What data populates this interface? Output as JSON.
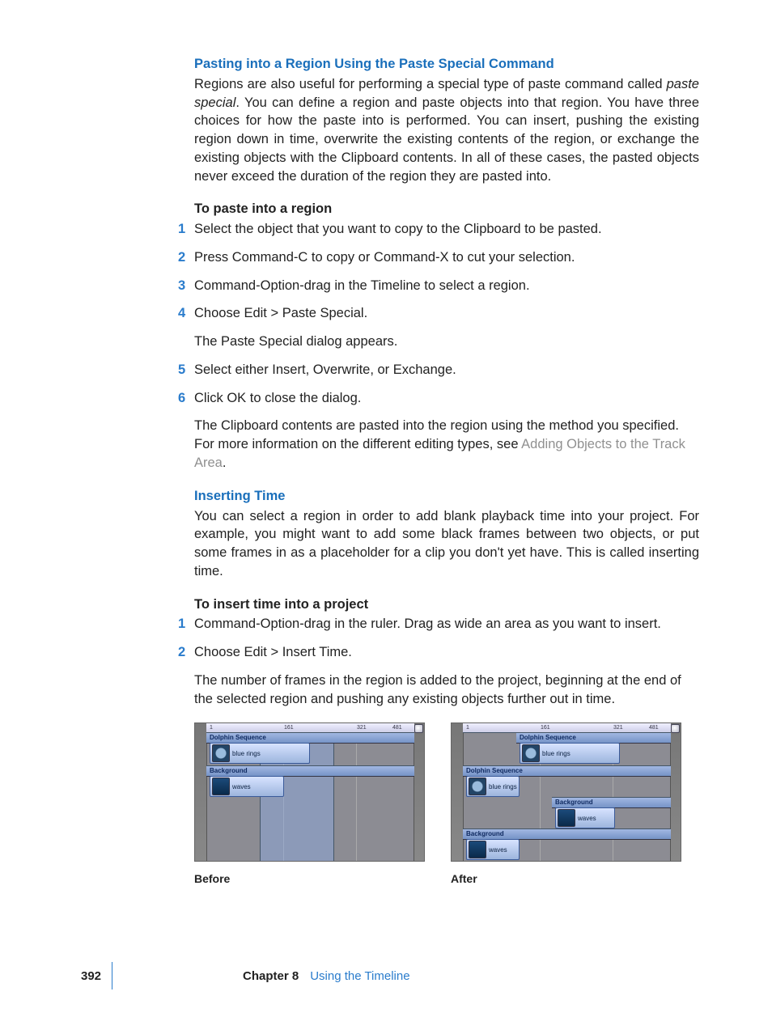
{
  "section1": {
    "heading": "Pasting into a Region Using the Paste Special Command",
    "body_prefix": "Regions are also useful for performing a special type of paste command called ",
    "body_em": "paste special",
    "body_suffix": ". You can define a region and paste objects into that region. You have three choices for how the paste into is performed. You can insert, pushing the existing region down in time, overwrite the existing contents of the region, or exchange the existing objects with the Clipboard contents. In all of these cases, the pasted objects never exceed the duration of the region they are pasted into.",
    "task_heading": "To paste into a region",
    "steps": [
      "Select the object that you want to copy to the Clipboard to be pasted.",
      "Press Command-C to copy or Command-X to cut your selection.",
      "Command-Option-drag in the Timeline to select a region.",
      "Choose Edit > Paste Special."
    ],
    "after_step4": "The Paste Special dialog appears.",
    "step5": "Select either Insert, Overwrite, or Exchange.",
    "step6": "Click OK to close the dialog.",
    "result_prefix": "The Clipboard contents are pasted into the region using the method you specified. For more information on the different editing types, see ",
    "result_link": "Adding Objects to the Track Area",
    "result_suffix": "."
  },
  "section2": {
    "heading": "Inserting Time",
    "body": "You can select a region in order to add blank playback time into your project. For example, you might want to add some black frames between two objects, or put some frames in as a placeholder for a clip you don't yet have. This is called inserting time.",
    "task_heading": "To insert time into a project",
    "steps": [
      "Command-Option-drag in the ruler. Drag as wide an area as you want to insert.",
      "Choose Edit > Insert Time."
    ],
    "result": "The number of frames in the region is added to the project, beginning at the end of the selected region and pushing any existing objects further out in time."
  },
  "figures": {
    "ruler_ticks": [
      "1",
      "161",
      "321",
      "481"
    ],
    "layer_dolphin": "Dolphin Sequence",
    "layer_background": "Background",
    "clip_rings": "blue rings",
    "clip_waves": "waves",
    "before_caption": "Before",
    "after_caption": "After"
  },
  "footer": {
    "page": "392",
    "chapter_label": "Chapter 8",
    "chapter_title": "Using the Timeline"
  }
}
